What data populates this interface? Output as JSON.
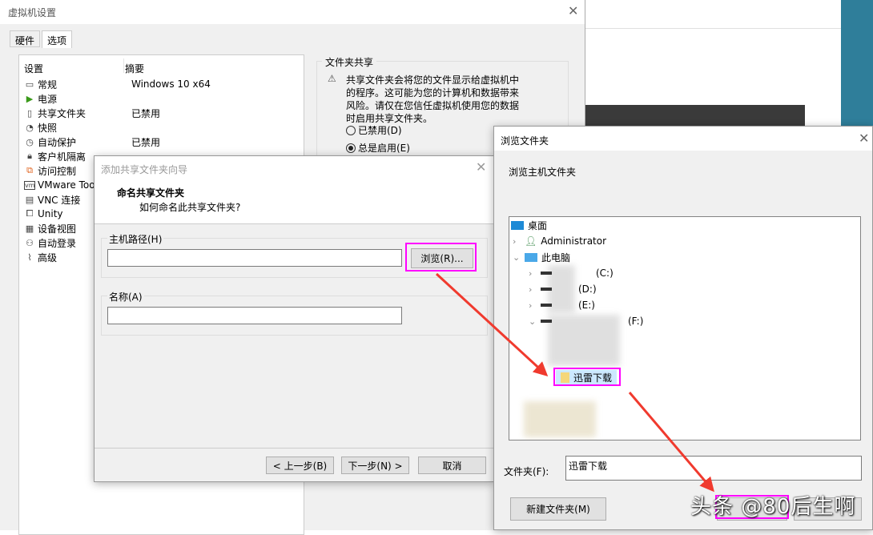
{
  "background": {
    "accent": "#2f7e9a"
  },
  "settings_window": {
    "title": "虚拟机设置",
    "tabs": [
      {
        "label": "硬件"
      },
      {
        "label": "选项",
        "selected": true
      }
    ],
    "columns": {
      "setting": "设置",
      "summary": "摘要"
    },
    "items": [
      {
        "label": "常规",
        "summary": "Windows 10 x64",
        "icon": "monitor-icon"
      },
      {
        "label": "电源",
        "summary": "",
        "icon": "play-icon"
      },
      {
        "label": "共享文件夹",
        "summary": "已禁用",
        "icon": "shared-folder-icon"
      },
      {
        "label": "快照",
        "summary": "",
        "icon": "snapshot-icon"
      },
      {
        "label": "自动保护",
        "summary": "已禁用",
        "icon": "clock-icon"
      },
      {
        "label": "客户机隔离",
        "summary": "",
        "icon": "lock-icon"
      },
      {
        "label": "访问控制",
        "summary": "",
        "icon": "access-control-icon"
      },
      {
        "label": "VMware Tools",
        "summary": "",
        "icon": "vm-icon"
      },
      {
        "label": "VNC 连接",
        "summary": "",
        "icon": "vnc-icon"
      },
      {
        "label": "Unity",
        "summary": "",
        "icon": "unity-icon"
      },
      {
        "label": "设备视图",
        "summary": "",
        "icon": "device-view-icon"
      },
      {
        "label": "自动登录",
        "summary": "",
        "icon": "users-icon"
      },
      {
        "label": "高级",
        "summary": "",
        "icon": "pulse-icon"
      }
    ],
    "folder_sharing": {
      "group_label": "文件夹共享",
      "warning": "共享文件夹会将您的文件显示给虚拟机中的程序。这可能为您的计算机和数据带来风险。请仅在您信任虚拟机使用您的数据时启用共享文件夹。",
      "options": [
        {
          "label": "已禁用(D)",
          "checked": false
        },
        {
          "label": "总是启用(E)",
          "checked": true
        }
      ]
    }
  },
  "wizard": {
    "title": "添加共享文件夹向导",
    "heading": "命名共享文件夹",
    "subheading": "如何命名此共享文件夹?",
    "host_path_label": "主机路径(H)",
    "host_path_value": "",
    "browse_label": "浏览(R)...",
    "name_label": "名称(A)",
    "name_value": "",
    "back_label": "< 上一步(B)",
    "next_label": "下一步(N) >",
    "cancel_label": "取消"
  },
  "browse_dialog": {
    "title": "浏览文件夹",
    "description": "浏览主机文件夹",
    "tree": {
      "desktop": "桌面",
      "admin": "Administrator",
      "this_pc": "此电脑",
      "drives": [
        "(C:)",
        "(D:)",
        "(E:)",
        "(F:)"
      ],
      "selected_folder": "迅雷下载"
    },
    "folder_label": "文件夹(F):",
    "folder_value": "迅雷下载",
    "new_folder_label": "新建文件夹(M)"
  },
  "annotation": {
    "highlight_color": "#ff00ff",
    "arrow_color": "#f03a2e"
  },
  "watermark": "头条 @80后生啊"
}
